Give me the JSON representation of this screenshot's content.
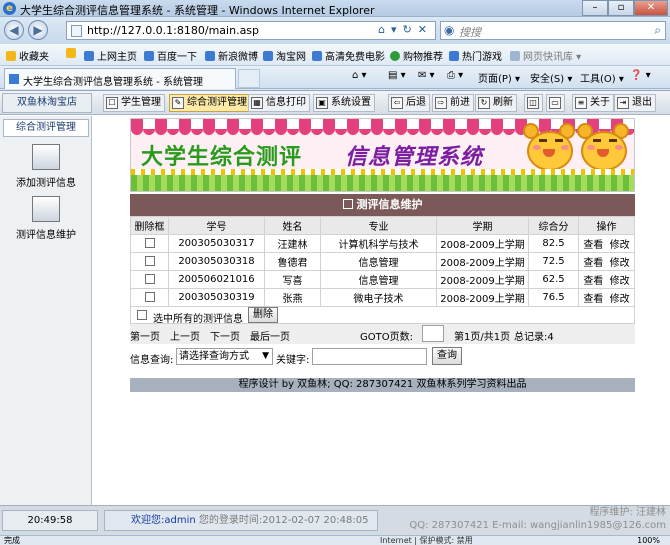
{
  "browser": {
    "window_title": "大学生综合测评信息管理系统 - 系统管理 - Windows Internet Explorer",
    "window_buttons": [
      "–",
      "▫",
      "✕"
    ],
    "url": "http://127.0.0.1:8180/main.asp",
    "search_placeholder": "搜搜",
    "favorites": [
      "收藏夹",
      "上网主页",
      "百度一下",
      "新浪微博",
      "淘宝网",
      "高清免费电影",
      "购物推荐",
      "热门游戏",
      "网页快讯库"
    ],
    "tab_title": "大学生综合测评信息管理系统 - 系统管理",
    "commands": [
      "页面(P)",
      "安全(S)",
      "工具(O)"
    ],
    "status_left": "完成",
    "status_middle": "Internet | 保护模式: 禁用",
    "status_zoom": "100%"
  },
  "app": {
    "shop_name": "双鱼林淘宝店",
    "toolbar": {
      "student_mgmt": "学生管理",
      "eval_mgmt": "综合测评管理",
      "info_print": "信息打印",
      "sys_settings": "系统设置",
      "back": "后退",
      "forward": "前进",
      "refresh": "刷新",
      "about": "关于",
      "exit": "退出"
    },
    "left_menu": {
      "header": "综合测评管理",
      "items": [
        "添加测评信息",
        "测评信息维护"
      ]
    },
    "banner": {
      "title_part1": "大学生综合测评",
      "title_part2": "信息管理系统"
    },
    "panel_title": "测评信息维护",
    "table": {
      "headers": [
        "删除框",
        "学号",
        "姓名",
        "专业",
        "学期",
        "综合分",
        "操作"
      ],
      "rows": [
        {
          "id": "200305030317",
          "name": "汪建林",
          "major": "计算机科学与技术",
          "term": "2008-2009上学期",
          "score": "82.5",
          "view": "查看",
          "edit": "修改"
        },
        {
          "id": "200305030318",
          "name": "鲁德君",
          "major": "信息管理",
          "term": "2008-2009上学期",
          "score": "72.5",
          "view": "查看",
          "edit": "修改"
        },
        {
          "id": "200506021016",
          "name": "写喜",
          "major": "信息管理",
          "term": "2008-2009上学期",
          "score": "62.5",
          "view": "查看",
          "edit": "修改"
        },
        {
          "id": "200305030319",
          "name": "张燕",
          "major": "微电子技术",
          "term": "2008-2009上学期",
          "score": "76.5",
          "view": "查看",
          "edit": "修改"
        }
      ]
    },
    "select_all_label": "选中所有的测评信息",
    "delete_button": "删除",
    "pager": {
      "first": "第一页",
      "prev": "上一页",
      "next": "下一页",
      "last": "最后一页",
      "goto_label": "GOTO页数:",
      "page_info": "第1页/共1页",
      "total": "总记录:4"
    },
    "query": {
      "label": "信息查询:",
      "select_value": "请选择查询方式",
      "keyword_label": "关键字:",
      "keyword_value": "",
      "button": "查询"
    },
    "footer": "程序设计 by 双鱼林; QQ: 287307421 双鱼林系列学习资料出品",
    "clock": "20:49:58",
    "welcome_prefix": "欢迎您:admin",
    "welcome_login": "您的登录时间:2012-02-07 20:48:05",
    "maintainer_line1": "程序维护: 汪建林",
    "maintainer_line2": "QQ: 287307421 E-mail: wangjianlin1985@126.com"
  },
  "colors": {
    "panel_header": "#7b5958",
    "banner_title_green": "#2a9a1c",
    "banner_title_purple": "#7c1ea2",
    "welcome_blue": "#1538a8"
  }
}
